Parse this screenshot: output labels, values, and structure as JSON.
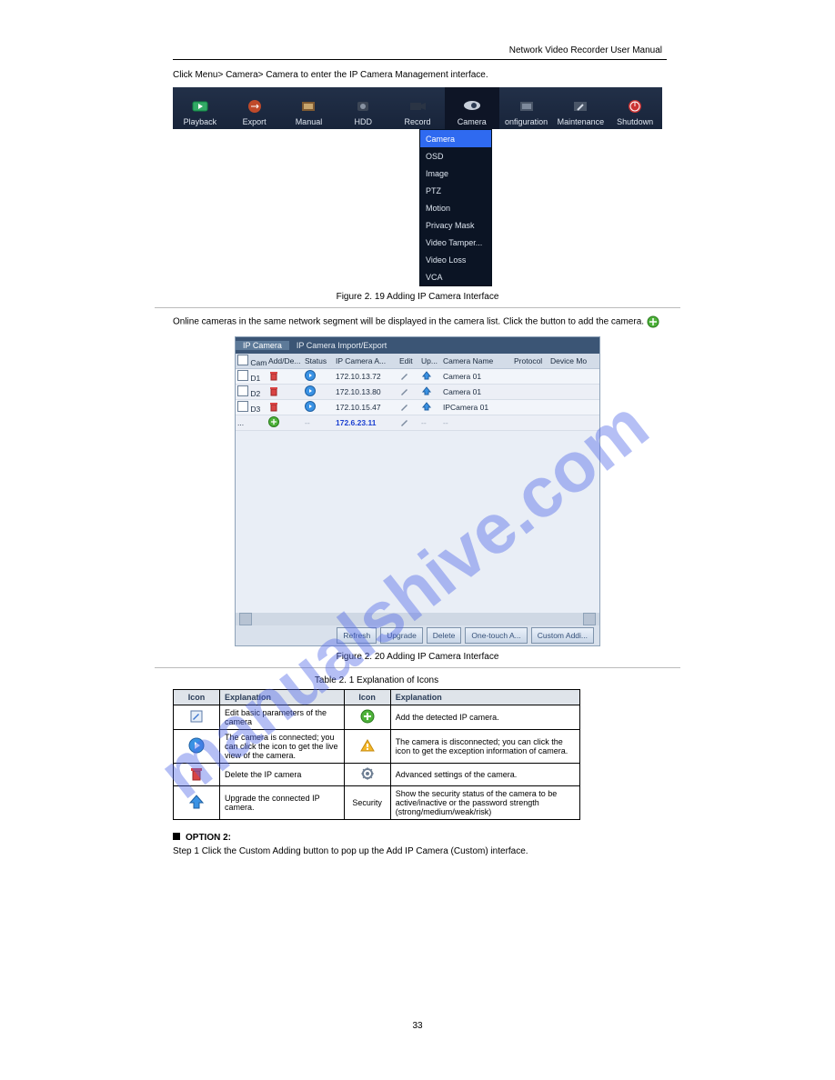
{
  "doc_title": "Network Video Recorder User Manual",
  "intro_text": "Click Menu> Camera> Camera to enter the IP Camera Management interface.",
  "menubar": {
    "items": [
      {
        "label": "Playback"
      },
      {
        "label": "Export"
      },
      {
        "label": "Manual"
      },
      {
        "label": "HDD"
      },
      {
        "label": "Record"
      },
      {
        "label": "Camera",
        "active": true
      },
      {
        "label": "onfiguration"
      },
      {
        "label": "Maintenance"
      },
      {
        "label": "Shutdown"
      }
    ]
  },
  "dropdown": {
    "items": [
      {
        "label": "Camera",
        "selected": true
      },
      {
        "label": "OSD"
      },
      {
        "label": "Image"
      },
      {
        "label": "PTZ"
      },
      {
        "label": "Motion"
      },
      {
        "label": "Privacy Mask"
      },
      {
        "label": "Video Tamper..."
      },
      {
        "label": "Video Loss"
      },
      {
        "label": "VCA"
      }
    ]
  },
  "fig1_caption": "Figure 2. 19 Adding IP Camera Interface",
  "panel": {
    "tabs": [
      {
        "label": "IP Camera",
        "active": true
      },
      {
        "label": "IP Camera Import/Export"
      }
    ],
    "headers": [
      "Cam...",
      "Add/De...",
      "Status",
      "IP Camera A...",
      "Edit",
      "Up...",
      "Camera Name",
      "Protocol",
      "Device Mo"
    ],
    "rows": [
      {
        "cam": "D1",
        "ip": "172.10.13.72",
        "name": "Camera 01",
        "type": "delete"
      },
      {
        "cam": "D2",
        "ip": "172.10.13.80",
        "name": "Camera 01",
        "type": "delete"
      },
      {
        "cam": "D3",
        "ip": "172.10.15.47",
        "name": "IPCamera 01",
        "type": "delete"
      },
      {
        "cam": "...",
        "ip": "172.6.23.11",
        "name": "",
        "type": "add"
      }
    ],
    "buttons": [
      "Refresh",
      "Upgrade",
      "Delete",
      "One-touch A...",
      "Custom Addi..."
    ]
  },
  "fig2_caption": "Figure 2. 20 Adding IP Camera Interface",
  "between_text": "Online cameras in the same network segment will be displayed in the camera list. Click the          button to add the camera.",
  "explain": {
    "caption": "Table 2. 1 Explanation of Icons",
    "head": [
      "Icon",
      "Explanation",
      "Icon",
      "Explanation"
    ],
    "rows": [
      {
        "l": "edit-icon",
        "ldesc": "Edit basic parameters of the camera",
        "r": "add-icon",
        "rdesc": "Add the detected IP camera."
      },
      {
        "l": "play-icon",
        "ldesc": "The camera is connected; you can click the icon to get the live view of the camera.",
        "r": "warning-icon",
        "rdesc": "The camera is disconnected; you can click the icon to get the exception information of camera."
      },
      {
        "l": "delete-icon",
        "ldesc": "Delete the IP camera",
        "r": "advanced-icon",
        "rdesc": "Advanced settings of the camera."
      },
      {
        "l": "up-icon",
        "ldesc": "Upgrade the connected IP camera.",
        "r": "",
        "rdesc": "Show the security status of the camera to be active/inactive or the password strength (strong/medium/weak/risk)"
      }
    ],
    "security_label": "Security"
  },
  "option2": {
    "heading": "OPTION 2:",
    "step1": "Step 1 Click the Custom Adding button to pop up the Add IP Camera (Custom) interface."
  },
  "page_number": "33",
  "watermark": "manualshive.com"
}
